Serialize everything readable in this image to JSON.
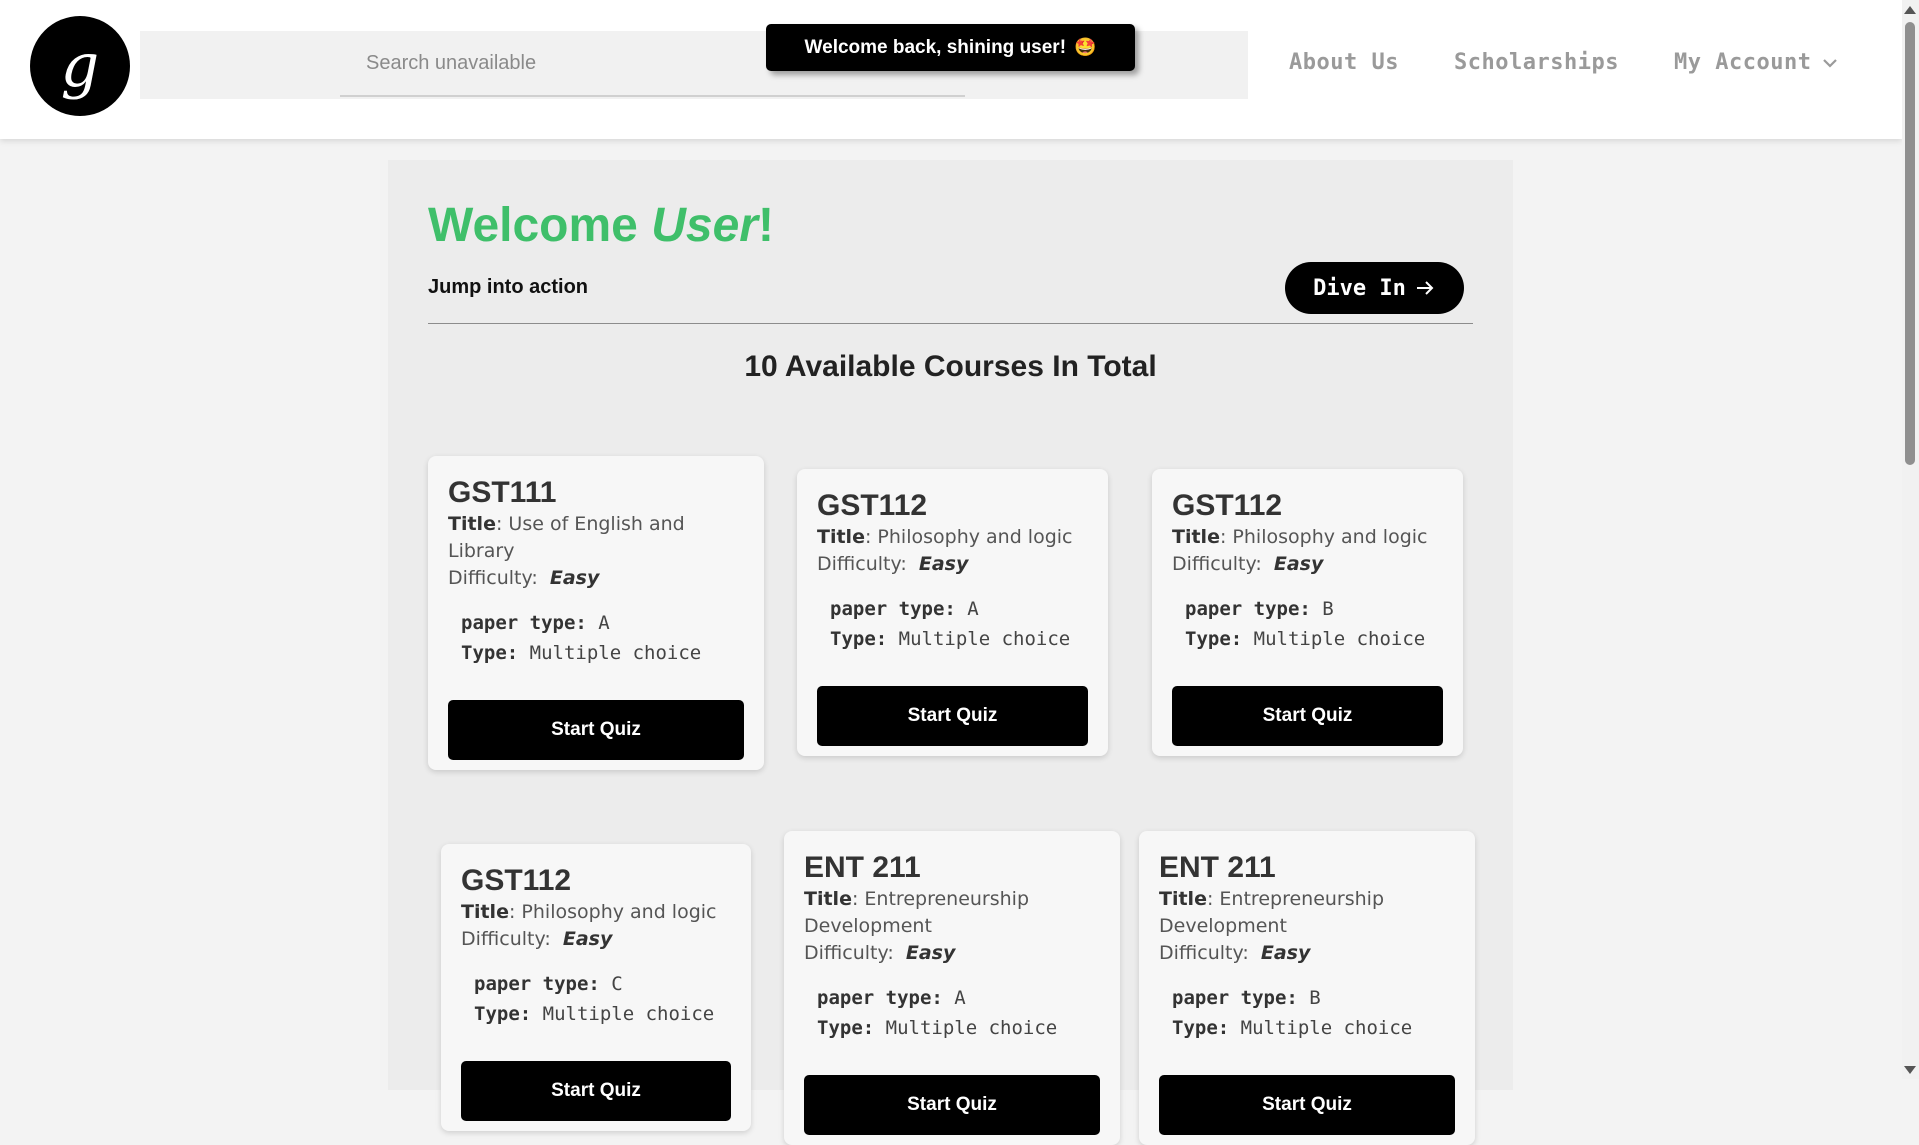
{
  "header": {
    "logo_glyph": "g",
    "search_placeholder": "Search unavailable",
    "toast": "Welcome back, shining user!",
    "toast_emoji": "🤩",
    "nav": {
      "about": "About Us",
      "scholarships": "Scholarships",
      "account": "My Account"
    }
  },
  "main": {
    "welcome_prefix": "Welcome ",
    "welcome_name": "User",
    "welcome_suffix": "!",
    "jump_text": "Jump into action",
    "dive_label": "Dive In",
    "total_heading": "10 Available Courses In Total",
    "labels": {
      "title": "Title",
      "difficulty": "Difficulty:",
      "paper_type": "paper type:",
      "type": "Type:"
    },
    "courses": [
      {
        "code": "GST111",
        "title": "Use of English and Library",
        "difficulty": "Easy",
        "paper_type": "A",
        "type": "Multiple choice",
        "button": "Start Quiz"
      },
      {
        "code": "GST112",
        "title": "Philosophy and logic",
        "difficulty": "Easy",
        "paper_type": "A",
        "type": "Multiple choice",
        "button": "Start Quiz"
      },
      {
        "code": "GST112",
        "title": "Philosophy and logic",
        "difficulty": "Easy",
        "paper_type": "B",
        "type": "Multiple choice",
        "button": "Start Quiz"
      },
      {
        "code": "GST112",
        "title": "Philosophy and logic",
        "difficulty": "Easy",
        "paper_type": "C",
        "type": "Multiple choice",
        "button": "Start Quiz"
      },
      {
        "code": "ENT 211",
        "title": "Entrepreneurship Development",
        "difficulty": "Easy",
        "paper_type": "A",
        "type": "Multiple choice",
        "button": "Start Quiz"
      },
      {
        "code": "ENT 211",
        "title": "Entrepreneurship Development",
        "difficulty": "Easy",
        "paper_type": "B",
        "type": "Multiple choice",
        "button": "Start Quiz"
      }
    ]
  },
  "colors": {
    "accent_green": "#3fbf6a",
    "button_black": "#000000"
  }
}
